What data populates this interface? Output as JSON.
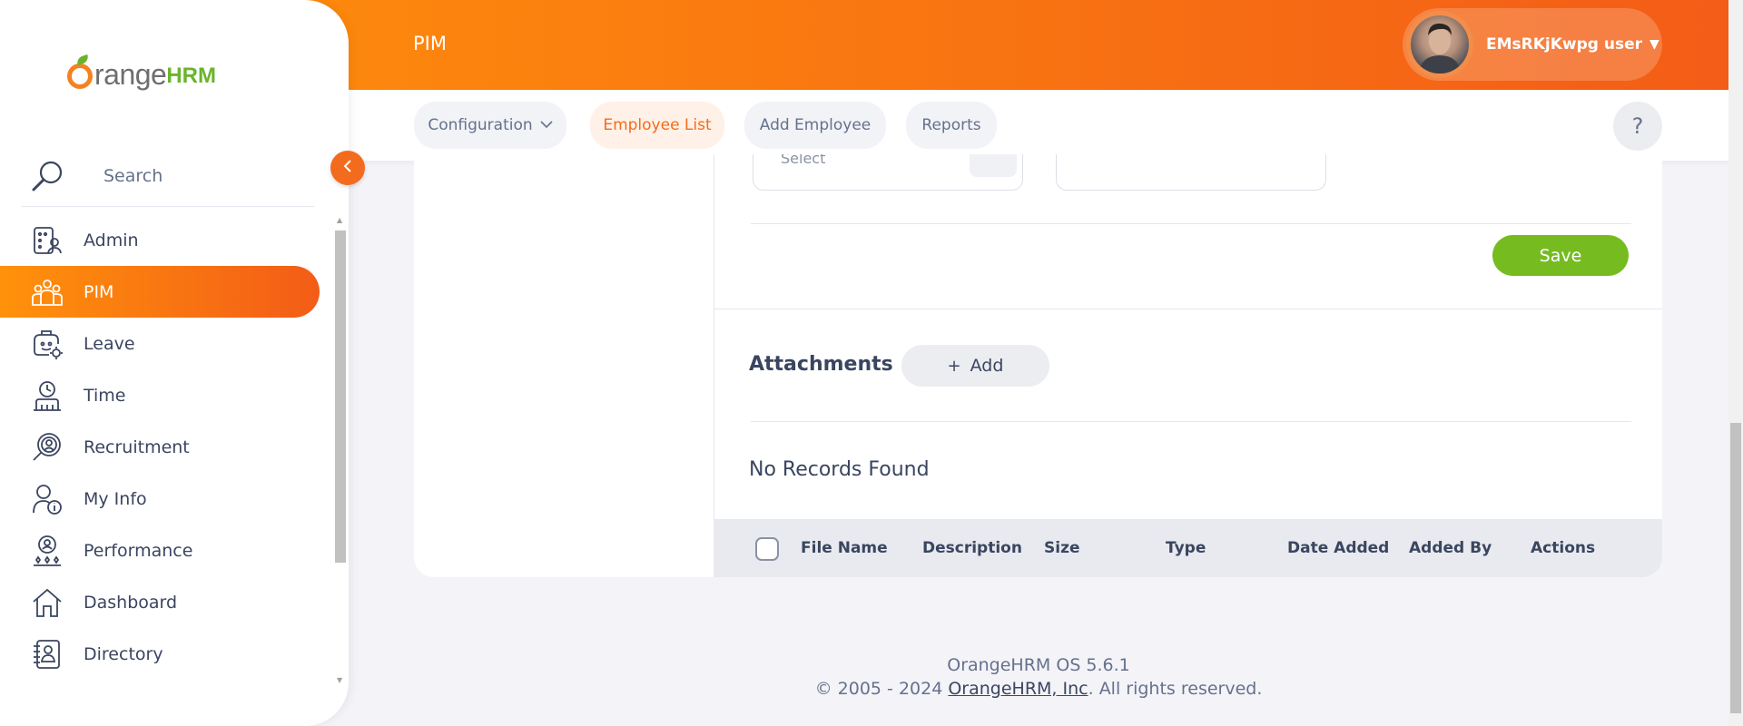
{
  "brand": {
    "logo_text": "range",
    "logo_suffix": "HRM"
  },
  "sidebar": {
    "search_label": "Search",
    "items": [
      {
        "label": "Admin",
        "icon": "admin-icon",
        "active": false
      },
      {
        "label": "PIM",
        "icon": "pim-icon",
        "active": true
      },
      {
        "label": "Leave",
        "icon": "leave-icon",
        "active": false
      },
      {
        "label": "Time",
        "icon": "time-icon",
        "active": false
      },
      {
        "label": "Recruitment",
        "icon": "recruitment-icon",
        "active": false
      },
      {
        "label": "My Info",
        "icon": "my-info-icon",
        "active": false
      },
      {
        "label": "Performance",
        "icon": "performance-icon",
        "active": false
      },
      {
        "label": "Dashboard",
        "icon": "dashboard-icon",
        "active": false
      },
      {
        "label": "Directory",
        "icon": "directory-icon",
        "active": false
      }
    ]
  },
  "header": {
    "module_title": "PIM",
    "user_name": "EMsRKjKwpg user"
  },
  "subnav": {
    "tabs": [
      {
        "label": "Configuration",
        "has_dropdown": true,
        "active": false
      },
      {
        "label": "Employee List",
        "has_dropdown": false,
        "active": true
      },
      {
        "label": "Add Employee",
        "has_dropdown": false,
        "active": false
      },
      {
        "label": "Reports",
        "has_dropdown": false,
        "active": false
      }
    ],
    "help_label": "?"
  },
  "form": {
    "select_text": "Select",
    "save_label": "Save"
  },
  "attachments": {
    "title": "Attachments",
    "add_label": "Add",
    "empty_text": "No Records Found",
    "columns": [
      "File Name",
      "Description",
      "Size",
      "Type",
      "Date Added",
      "Added By",
      "Actions"
    ]
  },
  "footer": {
    "version": "OrangeHRM OS 5.6.1",
    "copyright_prefix": "© 2005 - 2024 ",
    "company_link": "OrangeHRM, Inc",
    "copyright_suffix": ". All rights reserved."
  },
  "colors": {
    "accent": "#f36b1c",
    "accent_gradient_start": "#ff920b",
    "accent_gradient_end": "#f35c17",
    "save_green": "#76bc21",
    "text_dark": "#3a4560",
    "text_muted": "#64728c"
  }
}
